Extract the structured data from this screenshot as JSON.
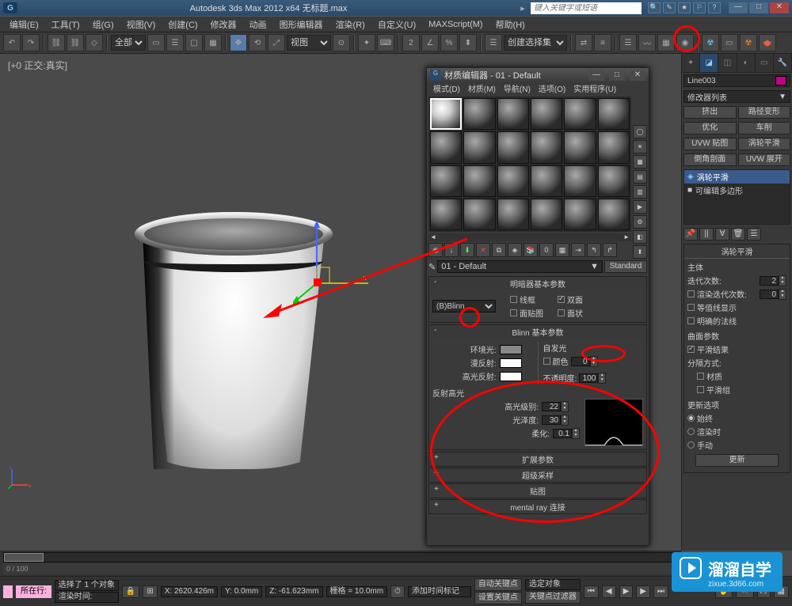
{
  "titlebar": {
    "app_logo": "G",
    "title": "Autodesk 3ds Max 2012 x64   无标题.max",
    "search_placeholder": "键入关键字或短语",
    "btn_min": "—",
    "btn_max": "□",
    "btn_close": "✕"
  },
  "menu": {
    "items": [
      "编辑(E)",
      "工具(T)",
      "组(G)",
      "视图(V)",
      "创建(C)",
      "修改器",
      "动画",
      "图形编辑器",
      "渲染(R)",
      "自定义(U)",
      "MAXScript(M)",
      "帮助(H)"
    ]
  },
  "toolbar": {
    "filter_all": "全部",
    "view_btn": "视图",
    "create_sel_set": "创建选择集"
  },
  "viewport": {
    "label": "[+0 正交:真实]"
  },
  "material_editor": {
    "title": "材质编辑器 - 01 - Default",
    "menu": [
      "模式(D)",
      "材质(M)",
      "导航(N)",
      "选项(O)",
      "实用程序(U)"
    ],
    "name": "01 - Default",
    "type_btn": "Standard",
    "rollout_shader": "明暗器基本参数",
    "shader": "(B)Blinn",
    "chk_wire": "线框",
    "chk_2side": "双面",
    "chk_facemap": "面贴图",
    "chk_faceted": "面状",
    "rollout_blinn": "Blinn 基本参数",
    "lbl_selfillum": "自发光",
    "lbl_color": "颜色",
    "val_color": "0",
    "lbl_ambient": "环境光:",
    "lbl_diffuse": "漫反射:",
    "lbl_specular": "高光反射:",
    "lbl_opacity": "不透明度:",
    "val_opacity": "100",
    "grp_spec": "反射高光",
    "lbl_speclevel": "高光级别:",
    "val_speclevel": "22",
    "lbl_gloss": "光泽度:",
    "val_gloss": "30",
    "lbl_soften": "柔化:",
    "val_soften": "0.1",
    "roll_ext": "扩展参数",
    "roll_super": "超级采样",
    "roll_maps": "贴图",
    "roll_mray": "mental ray 连接"
  },
  "right_panel": {
    "obj_name": "Line003",
    "mod_list_label": "修改器列表",
    "btns": [
      "挤出",
      "路径变形",
      "优化",
      "车削",
      "UVW 贴图",
      "涡轮平滑",
      "倒角剖面",
      "UVW 展开"
    ],
    "stack": [
      "涡轮平滑",
      "可编辑多边形"
    ],
    "rollout_ts": "涡轮平滑",
    "grp_main": "主体",
    "lbl_iter": "迭代次数:",
    "val_iter": "2",
    "lbl_render_iter": "渲染迭代次数:",
    "val_render_iter": "0",
    "chk_isoline": "等值线显示",
    "chk_explicit": "明确的法线",
    "grp_surface": "曲面参数",
    "chk_smooth_result": "平滑结果",
    "lbl_sep": "分隔方式:",
    "chk_material": "材质",
    "chk_smgroup": "平滑组",
    "grp_update": "更新选项",
    "opt_always": "始终",
    "opt_render": "渲染时",
    "opt_manual": "手动",
    "btn_update": "更新"
  },
  "status": {
    "sel_info": "选择了 1 个对象",
    "x": "X: 2620.426m",
    "y": "Y: 0.0mm",
    "z": "Z: -61.623mm",
    "grid": "栅格 = 10.0mm",
    "autokey": "自动关键点",
    "selkey": "选定对象",
    "setkey": "设置关键点",
    "keyfilter": "关键点过滤器",
    "add_time_tag": "添加时间标记",
    "current_loc": "所在行:",
    "render_time_label": "渲染时间:",
    "frame_range": "0 / 100"
  },
  "watermark": {
    "big": "溜溜自学",
    "small": "zixue.3d66.com"
  }
}
